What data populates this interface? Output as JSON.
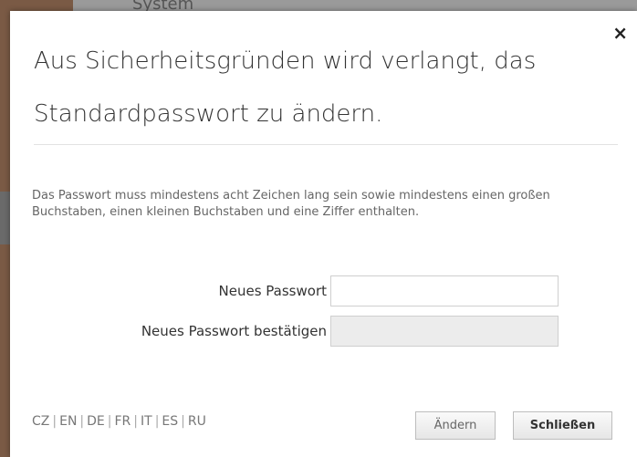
{
  "background": {
    "partial_text": "System"
  },
  "dialog": {
    "title": "Aus Sicherheitsgründen wird verlangt, das Standardpasswort zu ändern.",
    "close_symbol": "×",
    "info_text": "Das Passwort muss mindestens acht Zeichen lang sein sowie mindestens einen großen Buchstaben, einen kleinen Buchstaben und eine Ziffer enthalten.",
    "fields": {
      "new_password": {
        "label": "Neues Passwort",
        "value": "",
        "placeholder": ""
      },
      "confirm_password": {
        "label": "Neues Passwort bestätigen",
        "value": "",
        "placeholder": "",
        "disabled": true
      }
    },
    "languages": [
      "CZ",
      "EN",
      "DE",
      "FR",
      "IT",
      "ES",
      "RU"
    ],
    "buttons": {
      "change_label": "Ändern",
      "close_label": "Schließen"
    }
  },
  "colors": {
    "overlay": "#9a9a9a",
    "dialog_bg": "#ffffff",
    "title_text": "#333333",
    "muted_text": "#666666"
  },
  "icons": {
    "close": "close-icon"
  }
}
